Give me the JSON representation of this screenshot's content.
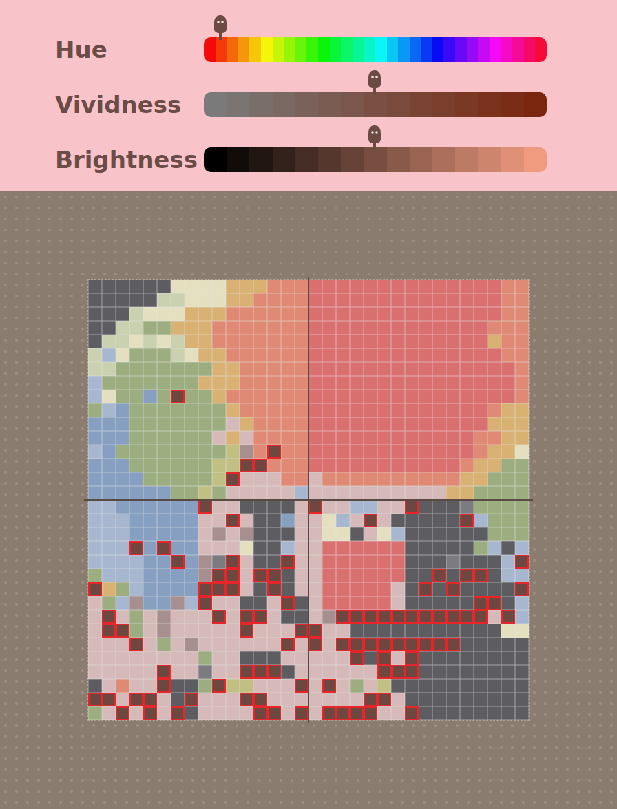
{
  "sliders": [
    {
      "label": "Hue",
      "level": 0.048,
      "kind": "hue"
    },
    {
      "label": "Vividness",
      "level": 0.498,
      "kind": "vividness"
    },
    {
      "label": "Brightness",
      "level": 0.498,
      "kind": "brightness"
    }
  ],
  "design": {
    "palette": {
      "G": "#5c5c61",
      "C": "#e3dfbf",
      "L": "#c9d1b0",
      "S": "#9cae80",
      "O": "#d9b173",
      "P": "#e08a76",
      "R": "#d9706f",
      "B": "#879fc1",
      "b": "#a7b7cf",
      "K": "#d6b9b9",
      "M": "#a88f8f",
      "D": "#6e4740",
      "g": "#7b7b81",
      "y": "#c2bf82"
    },
    "selected_color": "D",
    "rows": [
      "GGGGGGCCCCOOOPPPRRRRRRRRRRRRRRPP",
      "GGGGGLLCCCOOPPPPRRRRRRRRRRRRRRPP",
      "GGGLCCCOOOPPPPPPRRRRRRRRRRRRRRPP",
      "GGLLSSOOOPPPPPPPRRRRRRRRRRRRRPPP",
      "GLLCLCLOOPPPPPPPRRRRRRRRRRRRROPP",
      "LbCSSSLCOOPPPPPPRRRRRRRRRRRRRRPP",
      "LLSSSSSSSOOPPPPPRRRRRRRRRRRRRRRP",
      "bSSSSSSSOOOPPPPPRRRRRRRRRRRRRRRP",
      "bCSSBSDSSOPPPPPPRRRRRRRRRRRRRRRP",
      "SbBSSSSSSSOPPPPPRRRRRRRRRRRRRPOO",
      "BBBSSSSSSSKOPPPPRRRRRRRRRRRRROOO",
      "BBBSSSSSSKOKPPPPRRRRRRRRRRRRPPOO",
      "bBSSSSSSSSyMPDPPRRRRRRRRRRRRPOOC",
      "BBBSSSSSSyyDDPPPRRRRRRRRRRRPOOSS",
      "BBBBSSSSSyDKKKPPKPPPPPPPPPPOOSSS",
      "BBBBBBSSySKKKKKbKKKKKKKKKKOOSSSS",
      "bbBBBBBBDKKGGGGKDKKbbKKDGGGgSSSS",
      "bbbBBBBBKKDKGGBKKCbKDKGGGGGDbSSS",
      "bbbBBBBBKMKMGGGKKCCGKCbGGGGGGSSS",
      "bbbDBDBBKKKCGGbKKRRRRRRGGGGGSbGb",
      "bbbbBBDBMgDKGGDKKRRRRRRGGGgGGGbD",
      "SbbbBBBBMDDKDDGKKRRRRRRGGDGDDGbb",
      "DOSbBBBBDDDKGDGKKRRRRRKGDGDGGGGD",
      "KSbMBBMbDKKGGKDGKRRRRRKGGGGGDDGb",
      "KDKSKMKKKDKDDKGGKMDDDDDDDDDDDKDb",
      "KDDSKMKKKKKDKKKDDKKGGGGGGGGGGGCC",
      "KKKDKSKMKKKKKKDKDKDDDDDDDDDGGGGG",
      "KKKKKKKKSKKGGGKKKKKDGDKDGGGGGGGG",
      "KKKKKDKKgKKDDDGKKKKKKDDDGGGGGGGG",
      "GKPKKDGGSDyyKKKDKDKSKyGGGGGGGGGG",
      "DDKDDKGDKKKDDKKKKKKKDDKGGGGGGGGG",
      "SKDKDKDGKKKKDDKDKDDDDKKDGGGGGGGG"
    ]
  }
}
